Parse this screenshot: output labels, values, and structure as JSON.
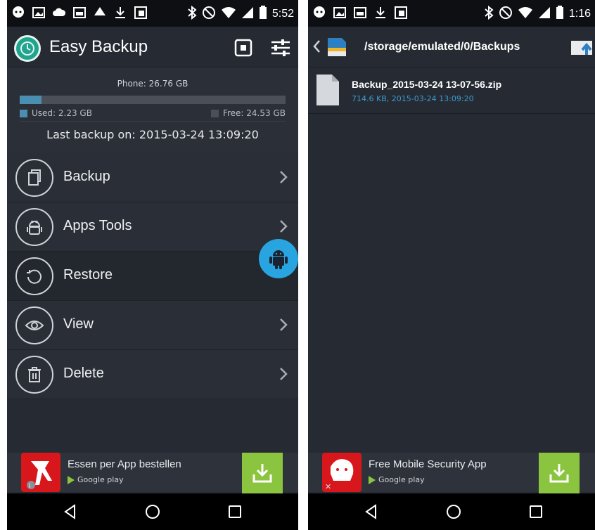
{
  "left": {
    "status": {
      "time": "5:52"
    },
    "app_title": "Easy Backup",
    "storage": {
      "phone_label": "Phone: 26.76 GB",
      "used_label": "Used: 2.23 GB",
      "free_label": "Free: 24.53 GB",
      "used_fraction": 0.083,
      "last_backup": "Last backup on: 2015-03-24 13:09:20"
    },
    "menu": [
      {
        "label": "Backup",
        "icon": "backup-icon"
      },
      {
        "label": "Apps Tools",
        "icon": "android-icon"
      },
      {
        "label": "Restore",
        "icon": "restore-icon"
      },
      {
        "label": "View",
        "icon": "eye-icon"
      },
      {
        "label": "Delete",
        "icon": "trash-icon"
      }
    ],
    "ad": {
      "title": "Essen per App bestellen",
      "store": "Google play"
    }
  },
  "right": {
    "status": {
      "time": "1:16"
    },
    "path": "/storage/emulated/0/Backups",
    "files": [
      {
        "name": "Backup_2015-03-24 13-07-56.zip",
        "meta": "714.6 KB, 2015-03-24 13:09:20"
      }
    ],
    "ad": {
      "title": "Free Mobile Security App",
      "store": "Google play"
    }
  },
  "colors": {
    "accent_blue": "#28a4e0",
    "download_green": "#8bc53f",
    "file_meta_blue": "#3c9ad0",
    "ad_red": "#d8171c"
  }
}
